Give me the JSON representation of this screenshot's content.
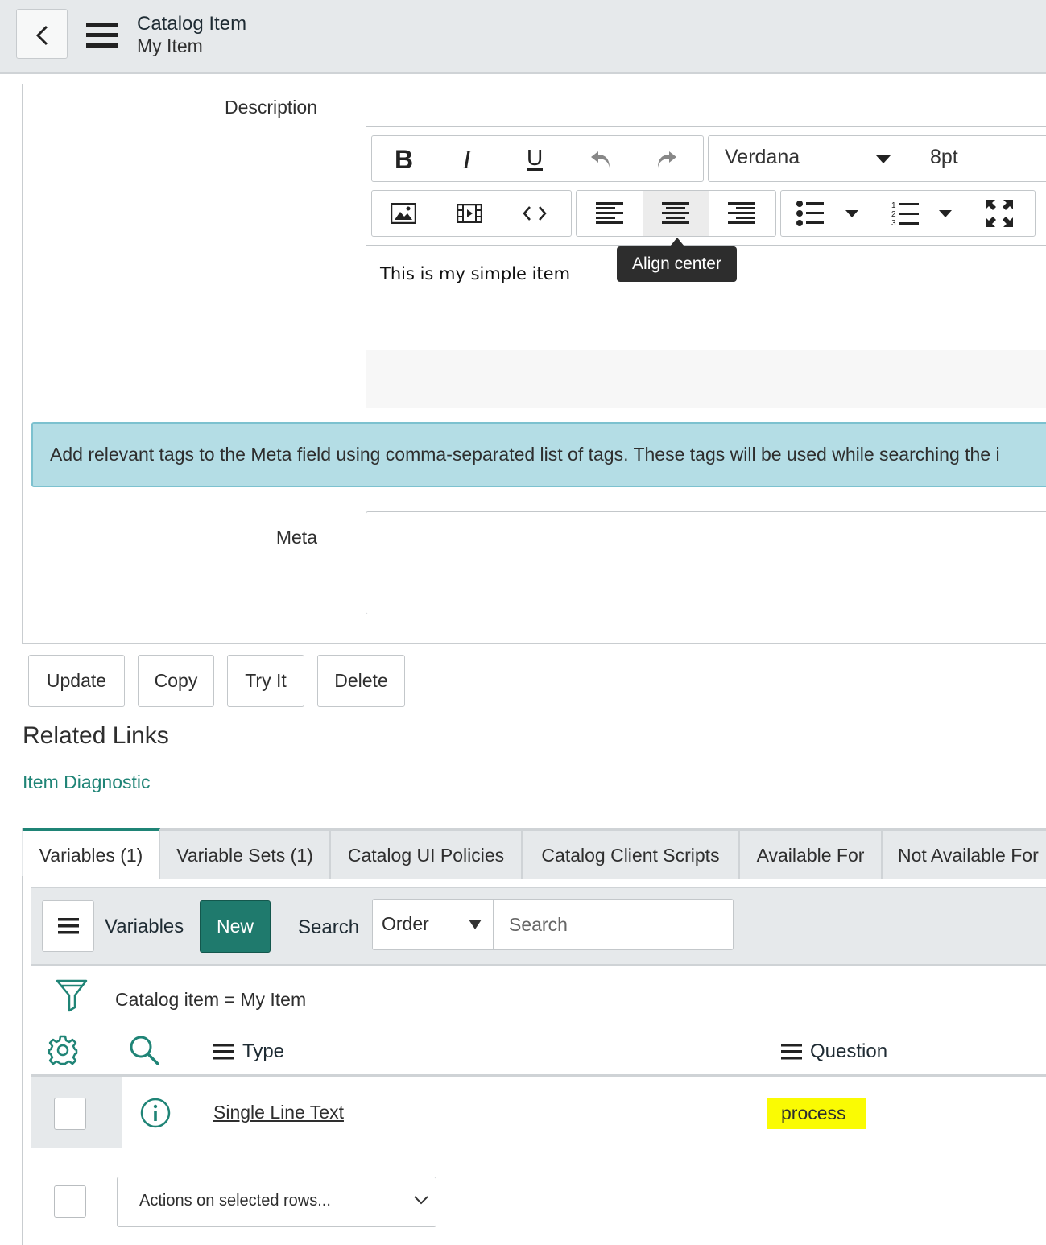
{
  "header": {
    "title": "Catalog Item",
    "subtitle": "My Item"
  },
  "form": {
    "description_label": "Description",
    "editor": {
      "font": "Verdana",
      "font_size": "8pt",
      "content": "This is my simple item",
      "tooltip": "Align center"
    },
    "info_banner": "Add relevant tags to the Meta field using comma-separated list of tags. These tags will be used while searching the i",
    "meta_label": "Meta",
    "meta_value": ""
  },
  "actions": {
    "update": "Update",
    "copy": "Copy",
    "try_it": "Try It",
    "delete": "Delete"
  },
  "related": {
    "title": "Related Links",
    "link": "Item Diagnostic"
  },
  "tabs": [
    {
      "label": "Variables (1)"
    },
    {
      "label": "Variable Sets (1)"
    },
    {
      "label": "Catalog UI Policies"
    },
    {
      "label": "Catalog Client Scripts"
    },
    {
      "label": "Available For"
    },
    {
      "label": "Not Available For"
    }
  ],
  "list": {
    "title": "Variables",
    "new_label": "New",
    "search_label": "Search",
    "order_option": "Order",
    "search_placeholder": "Search",
    "filter_text": "Catalog item = My Item",
    "columns": {
      "type": "Type",
      "question": "Question"
    },
    "rows": [
      {
        "type": "Single Line Text",
        "question": "process"
      }
    ],
    "actions_placeholder": "Actions on selected rows..."
  },
  "colors": {
    "accent": "#1f7a6d",
    "banner": "#b4dde5",
    "highlight": "#fafb03"
  }
}
